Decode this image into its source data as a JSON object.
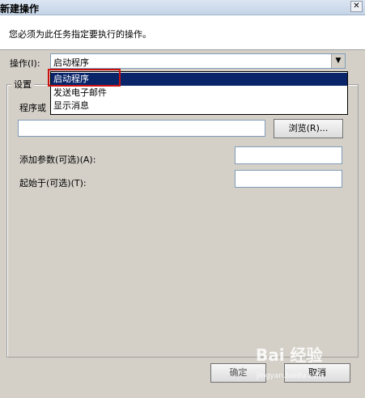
{
  "window": {
    "title": "新建操作",
    "close": "✕"
  },
  "header": {
    "subtitle": "您必须为此任务指定要执行的操作。"
  },
  "action": {
    "label": "操作(I):",
    "selected": "启动程序",
    "options": [
      "启动程序",
      "发送电子邮件",
      "显示消息"
    ]
  },
  "settings": {
    "group_title": "设置",
    "program_label": "程序或",
    "browse_label": "浏览(R)...",
    "args_label": "添加参数(可选)(A):",
    "start_label": "起始于(可选)(T):"
  },
  "footer": {
    "ok_label": "确定",
    "cancel_label": "取消"
  },
  "watermark": {
    "logo": "Bai  经验",
    "url": "jingyan.baidu.com"
  },
  "colors": {
    "selection": "#0a246a",
    "highlight_box": "#cc1111",
    "panel": "#d4d0c8"
  }
}
